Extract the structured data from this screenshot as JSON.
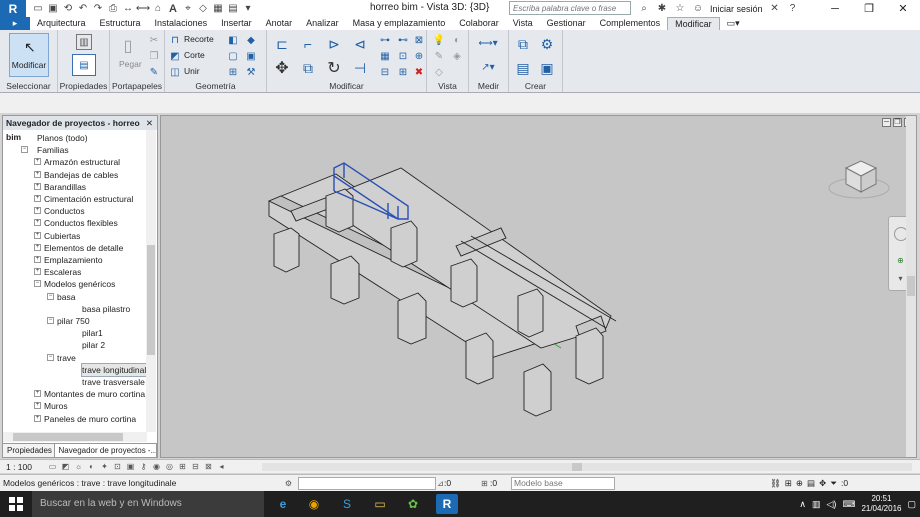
{
  "titlebar": {
    "logo": "R",
    "document_title": "horreo bim - Vista 3D: {3D}",
    "search_placeholder": "Escriba palabra clave o frase",
    "signin": "Iniciar sesión",
    "help": "?"
  },
  "tabs": [
    "Arquitectura",
    "Estructura",
    "Instalaciones",
    "Insertar",
    "Anotar",
    "Analizar",
    "Masa y emplazamiento",
    "Colaborar",
    "Vista",
    "Gestionar",
    "Complementos",
    "Modificar"
  ],
  "active_tab": "Modificar",
  "ribbon": {
    "modify_label": "Modificar",
    "paste_label": "Pegar",
    "cope_label": "Recorte",
    "cut_label": "Corte",
    "join_label": "Unir",
    "panels": {
      "select": "Seleccionar",
      "properties": "Propiedades",
      "clipboard": "Portapapeles",
      "geometry": "Geometría",
      "modify": "Modificar",
      "view": "Vista",
      "measure": "Medir",
      "create": "Crear"
    }
  },
  "browser": {
    "title": "Navegador de proyectos - horreo bim",
    "items": [
      {
        "label": "Planos (todo)",
        "level": 0,
        "exp": "",
        "sel": false
      },
      {
        "label": "Familias",
        "level": 0,
        "exp": "-",
        "sel": false
      },
      {
        "label": "Armazón estructural",
        "level": 1,
        "exp": "+",
        "sel": false
      },
      {
        "label": "Bandejas de cables",
        "level": 1,
        "exp": "+",
        "sel": false
      },
      {
        "label": "Barandillas",
        "level": 1,
        "exp": "+",
        "sel": false
      },
      {
        "label": "Cimentación estructural",
        "level": 1,
        "exp": "+",
        "sel": false
      },
      {
        "label": "Conductos",
        "level": 1,
        "exp": "+",
        "sel": false
      },
      {
        "label": "Conductos flexibles",
        "level": 1,
        "exp": "+",
        "sel": false
      },
      {
        "label": "Cubiertas",
        "level": 1,
        "exp": "+",
        "sel": false
      },
      {
        "label": "Elementos de detalle",
        "level": 1,
        "exp": "+",
        "sel": false
      },
      {
        "label": "Emplazamiento",
        "level": 1,
        "exp": "+",
        "sel": false
      },
      {
        "label": "Escaleras",
        "level": 1,
        "exp": "+",
        "sel": false
      },
      {
        "label": "Modelos genéricos",
        "level": 1,
        "exp": "-",
        "sel": false
      },
      {
        "label": "basa",
        "level": 2,
        "exp": "-",
        "sel": false
      },
      {
        "label": "basa pilastro",
        "level": 3,
        "exp": "",
        "sel": false
      },
      {
        "label": "pilar 750",
        "level": 2,
        "exp": "-",
        "sel": false
      },
      {
        "label": "pilar1",
        "level": 3,
        "exp": "",
        "sel": false
      },
      {
        "label": "pilar 2",
        "level": 3,
        "exp": "",
        "sel": false
      },
      {
        "label": "trave",
        "level": 2,
        "exp": "-",
        "sel": false
      },
      {
        "label": "trave longitudinale",
        "level": 3,
        "exp": "",
        "sel": true
      },
      {
        "label": "trave trasversale",
        "level": 3,
        "exp": "",
        "sel": false
      },
      {
        "label": "Montantes de muro cortina",
        "level": 1,
        "exp": "+",
        "sel": false
      },
      {
        "label": "Muros",
        "level": 1,
        "exp": "+",
        "sel": false
      },
      {
        "label": "Paneles de muro cortina",
        "level": 1,
        "exp": "+",
        "sel": false
      }
    ],
    "tab_properties": "Propiedades",
    "tab_browser": "Navegador de proyectos -..."
  },
  "viewbar": {
    "scale": "1 : 100"
  },
  "status": {
    "text": "Modelos genéricos : trave : trave longitudinale",
    "zero1": ":0",
    "zero2": ":0",
    "model": "Modelo base",
    "filter": ":0"
  },
  "taskbar": {
    "search": "Buscar en la web y en Windows",
    "time": "20:51",
    "date": "21/04/2016"
  }
}
